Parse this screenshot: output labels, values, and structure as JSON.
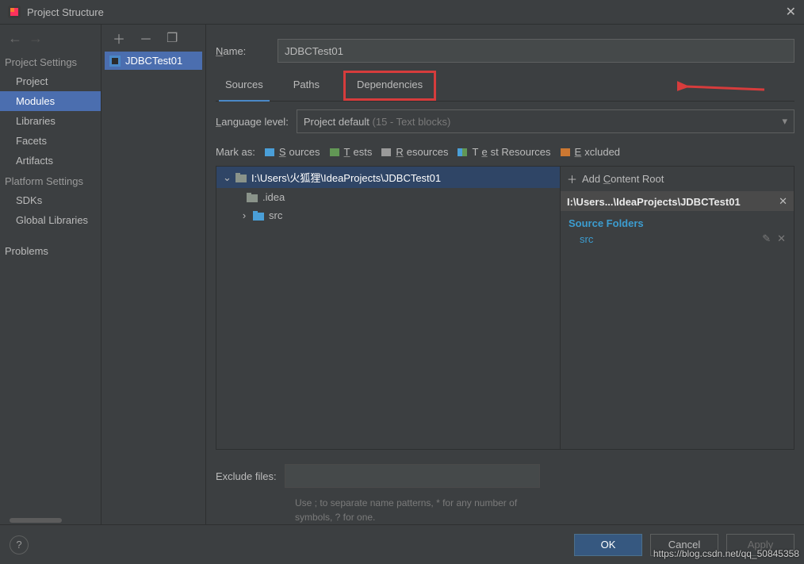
{
  "window": {
    "title": "Project Structure"
  },
  "sidebar": {
    "section1": "Project Settings",
    "items1": [
      "Project",
      "Modules",
      "Libraries",
      "Facets",
      "Artifacts"
    ],
    "section2": "Platform Settings",
    "items2": [
      "SDKs",
      "Global Libraries"
    ],
    "section3": "",
    "problems": "Problems"
  },
  "modules": {
    "name": "JDBCTest01"
  },
  "name_row": {
    "label": "Name:",
    "value": "JDBCTest01"
  },
  "tabs": {
    "sources": "Sources",
    "paths": "Paths",
    "dependencies": "Dependencies"
  },
  "language": {
    "label": "Language level:",
    "value": "Project default ",
    "hint": "(15 - Text blocks)"
  },
  "mark": {
    "label": "Mark as:",
    "sources": "Sources",
    "tests": "Tests",
    "resources": "Resources",
    "test_resources": "Test Resources",
    "excluded": "Excluded"
  },
  "tree": {
    "root": "I:\\Users\\火狐狸\\IdeaProjects\\JDBCTest01",
    "idea": ".idea",
    "src": "src"
  },
  "right": {
    "add": "Add Content Root",
    "root": "I:\\Users...\\IdeaProjects\\JDBCTest01",
    "source_folders": "Source Folders",
    "src": "src"
  },
  "exclude": {
    "label": "Exclude files:",
    "hint": "Use ; to separate name patterns, * for any number of symbols, ? for one."
  },
  "buttons": {
    "ok": "OK",
    "cancel": "Cancel",
    "apply": "Apply"
  },
  "watermark": "https://blog.csdn.net/qq_50845358"
}
